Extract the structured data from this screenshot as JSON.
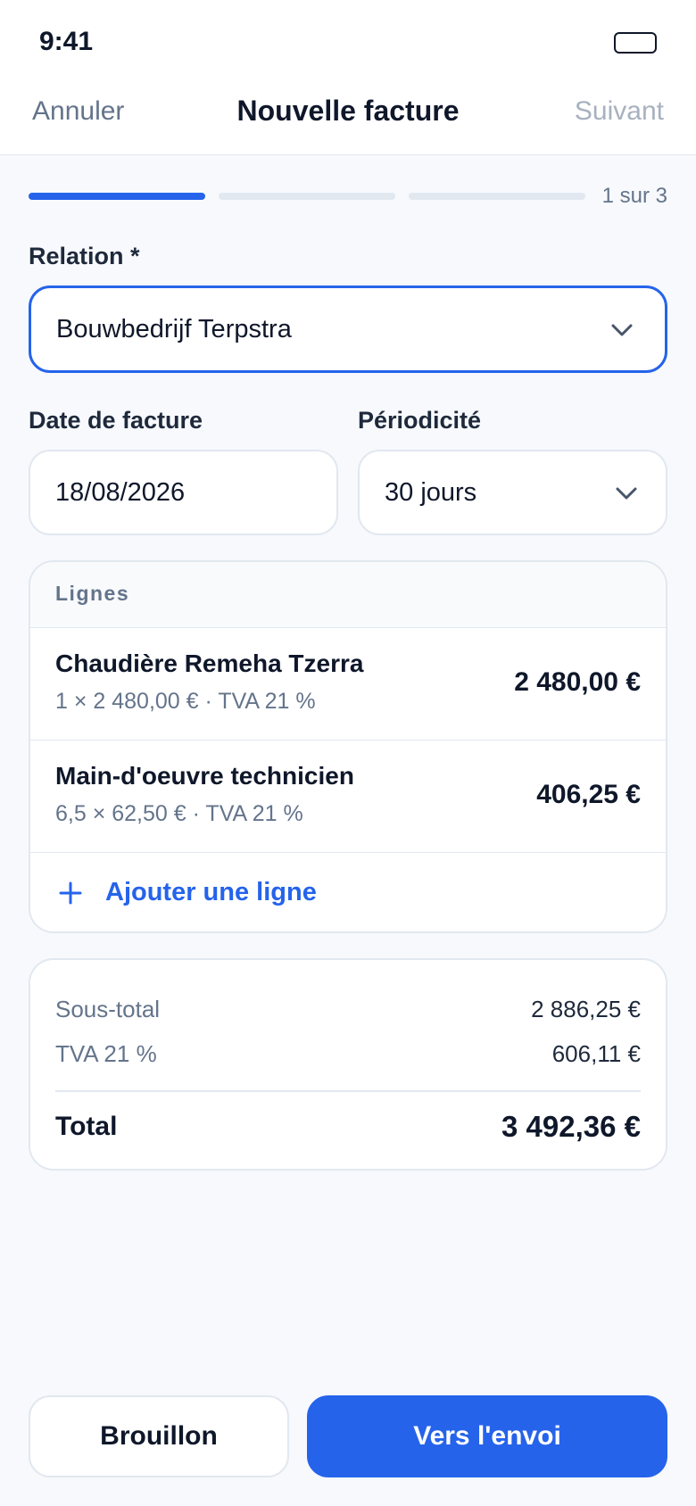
{
  "status_bar": {
    "time": "9:41"
  },
  "nav": {
    "cancel_label": "Annuler",
    "title": "Nouvelle facture",
    "next_label": "Suivant"
  },
  "progress": {
    "step_label": "1 sur 3",
    "current_step": 1,
    "total_steps": 3
  },
  "relation": {
    "label": "Relation *",
    "value": "Bouwbedrijf Terpstra"
  },
  "invoice_date": {
    "label": "Date de facture",
    "value": "18/08/2026"
  },
  "periodicity": {
    "label": "Périodicité",
    "value": "30 jours"
  },
  "lines": {
    "header": "Lignes",
    "items": [
      {
        "title": "Chaudière Remeha Tzerra",
        "detail": "1 × 2 480,00 € · TVA 21 %",
        "amount": "2 480,00 €"
      },
      {
        "title": "Main-d'oeuvre technicien",
        "detail": "6,5 × 62,50 € · TVA 21 %",
        "amount": "406,25 €"
      }
    ],
    "add_label": "Ajouter une ligne"
  },
  "totals": {
    "subtotal_label": "Sous-total",
    "subtotal_value": "2 886,25 €",
    "vat_label": "TVA 21 %",
    "vat_value": "606,11 €",
    "total_label": "Total",
    "total_value": "3 492,36 €"
  },
  "actions": {
    "draft_label": "Brouillon",
    "send_label": "Vers l'envoi"
  },
  "colors": {
    "accent": "#2563eb",
    "text": "#0f172a",
    "muted": "#64748b",
    "border": "#e2e8f0",
    "background": "#f7f9fc"
  }
}
